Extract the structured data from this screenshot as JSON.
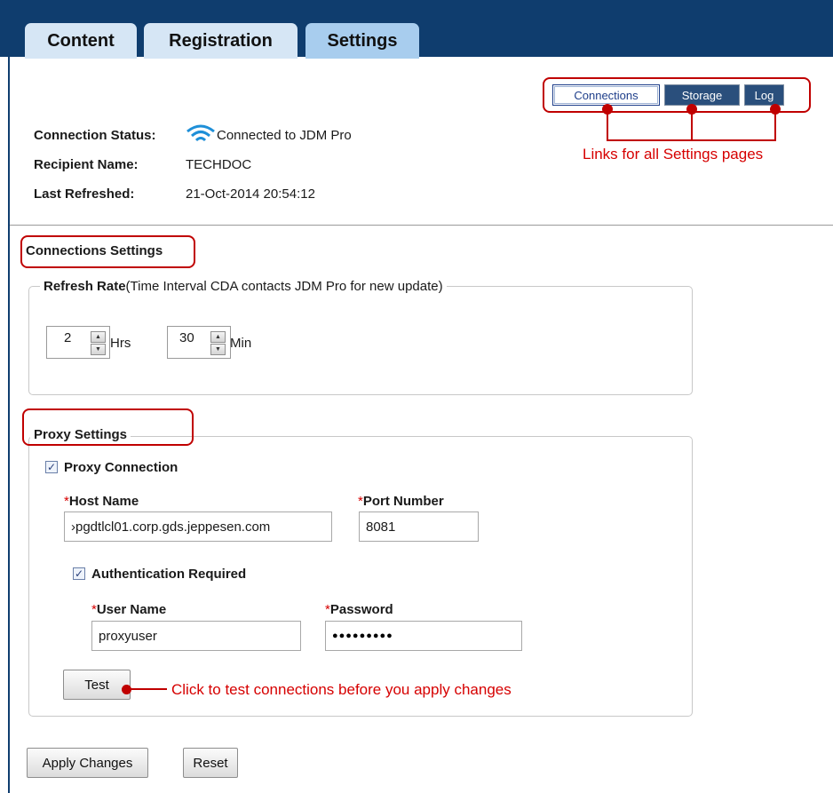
{
  "tabs": [
    {
      "label": "Content"
    },
    {
      "label": "Registration"
    },
    {
      "label": "Settings"
    }
  ],
  "status": {
    "connection_label": "Connection Status:",
    "connection_value": "Connected to JDM Pro",
    "recipient_label": "Recipient Name:",
    "recipient_value": "TECHDOC",
    "refreshed_label": "Last Refreshed:",
    "refreshed_value": "21-Oct-2014 20:54:12"
  },
  "subnav": {
    "connections": "Connections",
    "storage": "Storage",
    "log": "Log",
    "callout": "Links for all Settings pages"
  },
  "connections_settings": {
    "heading": "Connections Settings",
    "refresh_legend_bold": "Refresh Rate",
    "refresh_legend_rest": "(Time Interval CDA contacts JDM Pro for new update)",
    "hours_value": "2",
    "hours_unit": "Hrs",
    "minutes_value": "30",
    "minutes_unit": "Min"
  },
  "proxy": {
    "legend": "Proxy Settings",
    "proxy_connection_label": "Proxy Connection",
    "proxy_connection_checked": true,
    "host_label": "Host Name",
    "host_value": "›pgdtlcl01.corp.gds.jeppesen.com",
    "port_label": "Port Number",
    "port_value": "8081",
    "auth_label": "Authentication Required",
    "auth_checked": true,
    "user_label": "User Name",
    "user_value": "proxyuser",
    "password_label": "Password",
    "password_value": "●●●●●●●●●",
    "required_marker": "*",
    "test_button": "Test",
    "test_callout": "Click to test connections before you apply changes"
  },
  "actions": {
    "apply": "Apply Changes",
    "reset": "Reset"
  },
  "icons": {
    "wifi": "wifi-icon",
    "spin_up": "▲",
    "spin_down": "▼",
    "check": "✓"
  },
  "colors": {
    "tab_bar": "#0f3d6e",
    "annotation_red": "#c00000",
    "required_red": "#d60000"
  }
}
